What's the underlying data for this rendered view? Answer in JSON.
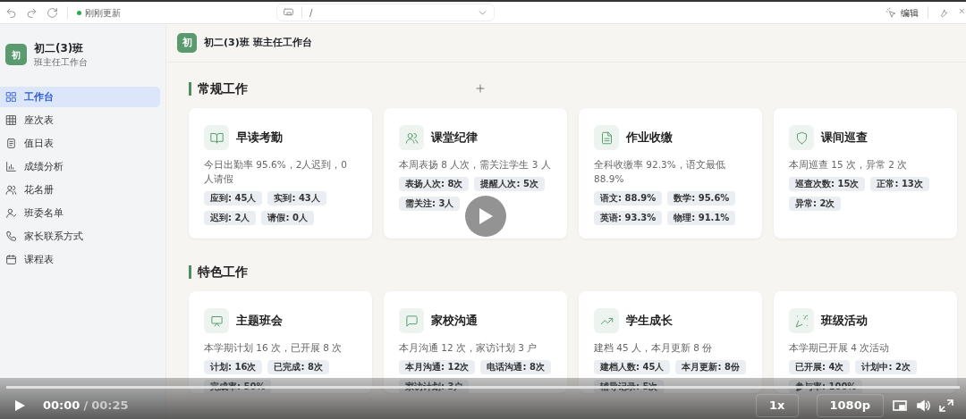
{
  "toolbar": {
    "status": "刚刚更新",
    "path": "/",
    "edit_label": "编辑"
  },
  "sidebar": {
    "badge": "初",
    "title": "初二(3)班",
    "subtitle": "班主任工作台",
    "items": [
      {
        "label": "工作台",
        "selected": true
      },
      {
        "label": "座次表",
        "selected": false
      },
      {
        "label": "值日表",
        "selected": false
      },
      {
        "label": "成绩分析",
        "selected": false
      },
      {
        "label": "花名册",
        "selected": false
      },
      {
        "label": "班委名单",
        "selected": false
      },
      {
        "label": "家长联系方式",
        "selected": false
      },
      {
        "label": "课程表",
        "selected": false
      }
    ]
  },
  "header": {
    "badge": "初",
    "title": "初二(3)班 班主任工作台"
  },
  "sections": [
    {
      "title": "常规工作",
      "cards": [
        {
          "title": "早读考勤",
          "summary": "今日出勤率 95.6%，2人迟到，0人请假",
          "tags": [
            "应到: 45人",
            "实到: 43人",
            "迟到: 2人",
            "请假: 0人"
          ]
        },
        {
          "title": "课堂纪律",
          "summary": "本周表扬 8 人次，需关注学生 3 人",
          "tags": [
            "表扬人次: 8次",
            "提醒人次: 5次",
            "需关注: 3人"
          ]
        },
        {
          "title": "作业收缴",
          "summary": "全科收缴率 92.3%，语文最低 88.9%",
          "tags": [
            "语文: 88.9%",
            "数学: 95.6%",
            "英语: 93.3%",
            "物理: 91.1%"
          ]
        },
        {
          "title": "课间巡查",
          "summary": "本周巡查 15 次，异常 2 次",
          "tags": [
            "巡查次数: 15次",
            "正常: 13次",
            "异常: 2次"
          ]
        }
      ]
    },
    {
      "title": "特色工作",
      "cards": [
        {
          "title": "主题班会",
          "summary": "本学期计划 16 次，已开展 8 次",
          "tags": [
            "计划: 16次",
            "已完成: 8次",
            "完成率: 50%"
          ]
        },
        {
          "title": "家校沟通",
          "summary": "本月沟通 12 次，家访计划 3 户",
          "tags": [
            "本月沟通: 12次",
            "电话沟通: 8次",
            "家访计划: 3户"
          ]
        },
        {
          "title": "学生成长",
          "summary": "建档 45 人，本月更新 8 份",
          "tags": [
            "建档人数: 45人",
            "本月更新: 8份",
            "辅导记录: 5次"
          ]
        },
        {
          "title": "班级活动",
          "summary": "本学期已开展 4 次活动",
          "tags": [
            "已开展: 4次",
            "计划中: 2次",
            "参与率: 100%"
          ]
        }
      ]
    }
  ],
  "player": {
    "current": "00:00",
    "separator": "/",
    "duration": "00:25",
    "speed": "1x",
    "quality": "1080p",
    "level": 0
  }
}
